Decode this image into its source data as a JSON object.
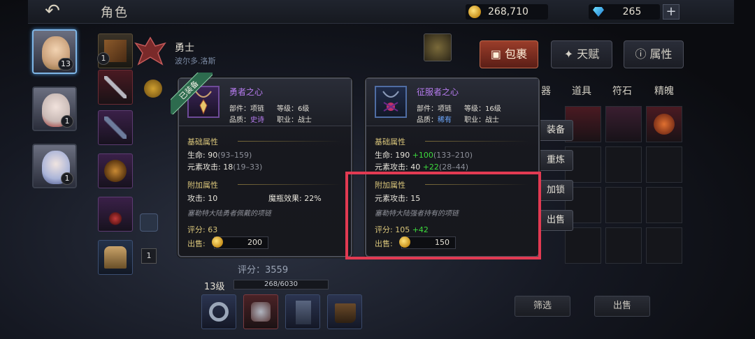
{
  "header": {
    "title": "角色",
    "gold": "268,710",
    "gems": "265"
  },
  "heroes": [
    {
      "level": "13"
    },
    {
      "level": "1"
    },
    {
      "level": "1"
    }
  ],
  "hero_info": {
    "name": "勇士",
    "subtitle": "波尔多.洛斯"
  },
  "slot_badges": {
    "slot1": "1",
    "side": "1"
  },
  "character": {
    "score": "评分：3559",
    "level": "13级",
    "exp": "268/6030"
  },
  "equipped_card": {
    "ribbon": "已装备",
    "name": "勇者之心",
    "name_color": "#b77cf0",
    "part_label": "部件：项链",
    "level_label": "等级：",
    "level_value": "6级",
    "quality_label": "品质：",
    "quality_value": "史诗",
    "quality_color": "#b77cf0",
    "job_label": "职业：战士",
    "base_title": "基础属性",
    "hp": "生命: 90",
    "hp_range": "(93–159)",
    "elem": "元素攻击: 18",
    "elem_range": "(19–33)",
    "extra_title": "附加属性",
    "atk": "攻击: 10",
    "magic": "魔瓶效果: 22%",
    "desc": "塞勒特大陆勇者佩戴的项链",
    "rating": "评分: 63",
    "sell_label": "出售:",
    "sell_price": "200"
  },
  "compare_card": {
    "name": "征服者之心",
    "name_color": "#b77cf0",
    "part_label": "部件：项链",
    "level_label": "等级：",
    "level_value": "16级",
    "quality_label": "品质：",
    "quality_value": "稀有",
    "quality_color": "#6ea9ff",
    "job_label": "职业：战士",
    "base_title": "基础属性",
    "hp": "生命: 190",
    "hp_up": "+100",
    "hp_range": "(133–210)",
    "elem": "元素攻击: 40",
    "elem_up": "+22",
    "elem_range": "(28–44)",
    "extra_title": "附加属性",
    "extra_elem": "元素攻击: 15",
    "desc": "塞勒特大陆强者持有的项链",
    "rating": "评分:",
    "rating_value": "105",
    "rating_up": "+42",
    "sell_label": "出售:",
    "sell_price": "150"
  },
  "tabs": [
    {
      "label": "包裹"
    },
    {
      "label": "天赋"
    },
    {
      "label": "属性"
    }
  ],
  "subtabs": [
    "器",
    "道具",
    "符石",
    "精魄"
  ],
  "actions": {
    "equip": "装备",
    "refine": "重炼",
    "lock": "加锁",
    "sell": "出售"
  },
  "bottom": {
    "filter": "筛选",
    "sell": "出售"
  }
}
